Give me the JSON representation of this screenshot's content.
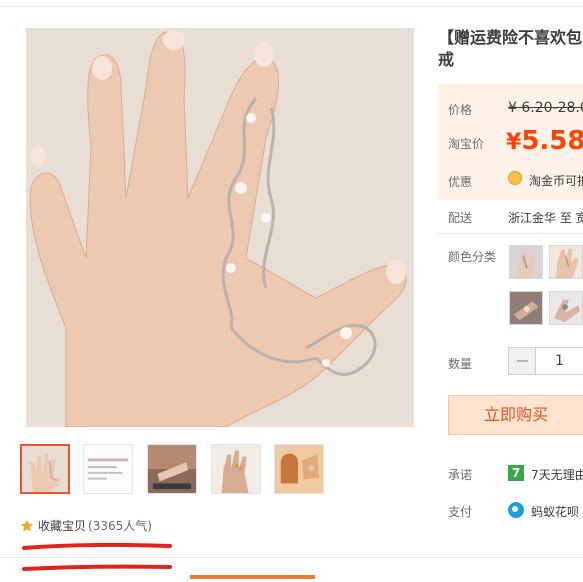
{
  "product": {
    "title_line1": "【赠运费险不喜欢包",
    "title_line2": "戒"
  },
  "price": {
    "label": "价格",
    "original": "¥ 6.20-28.0",
    "taobao_label": "淘宝价",
    "currency": "¥",
    "taobao_value": "5.58"
  },
  "discount": {
    "label": "优惠",
    "icon": "taojinbi-coin-icon",
    "text": "淘金币可抵"
  },
  "delivery": {
    "label": "配送",
    "value": "浙江金华 至 宽"
  },
  "color": {
    "label": "颜色分类"
  },
  "quantity": {
    "label": "数量",
    "value": "1"
  },
  "buy_button": "立即购买",
  "promise": {
    "label": "承诺",
    "icon_text": "7",
    "text": "7天无理由"
  },
  "payment": {
    "label": "支付",
    "text": "蚂蚁花呗"
  },
  "favorite": {
    "label": "收藏宝贝",
    "count": "(3365人气)"
  },
  "colors": {
    "accent": "#ff4400",
    "price_bg": "#fff2e8",
    "buy_bg": "#ffe4d0",
    "thumb_active": "#e4572e",
    "annotation": "#e0231c"
  }
}
